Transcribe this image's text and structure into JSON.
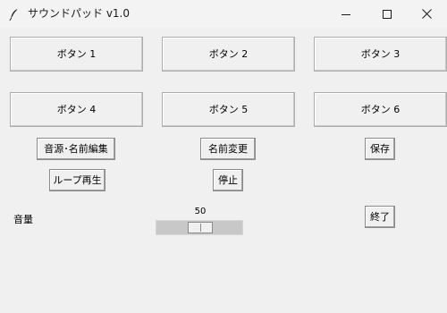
{
  "window": {
    "title": "サウンドパッド v1.0",
    "app_icon": "feather-icon",
    "controls": [
      "minimize-icon",
      "maximize-icon",
      "close-icon"
    ]
  },
  "pad_buttons": [
    "ボタン 1",
    "ボタン 2",
    "ボタン 3",
    "ボタン 4",
    "ボタン 5",
    "ボタン 6"
  ],
  "actions": {
    "edit_source": "音源･名前編集",
    "rename": "名前変更",
    "save": "保存",
    "loop_play": "ループ再生",
    "stop": "停止",
    "quit": "終了"
  },
  "volume": {
    "label": "音量",
    "value": "50",
    "fraction": 0.5
  }
}
